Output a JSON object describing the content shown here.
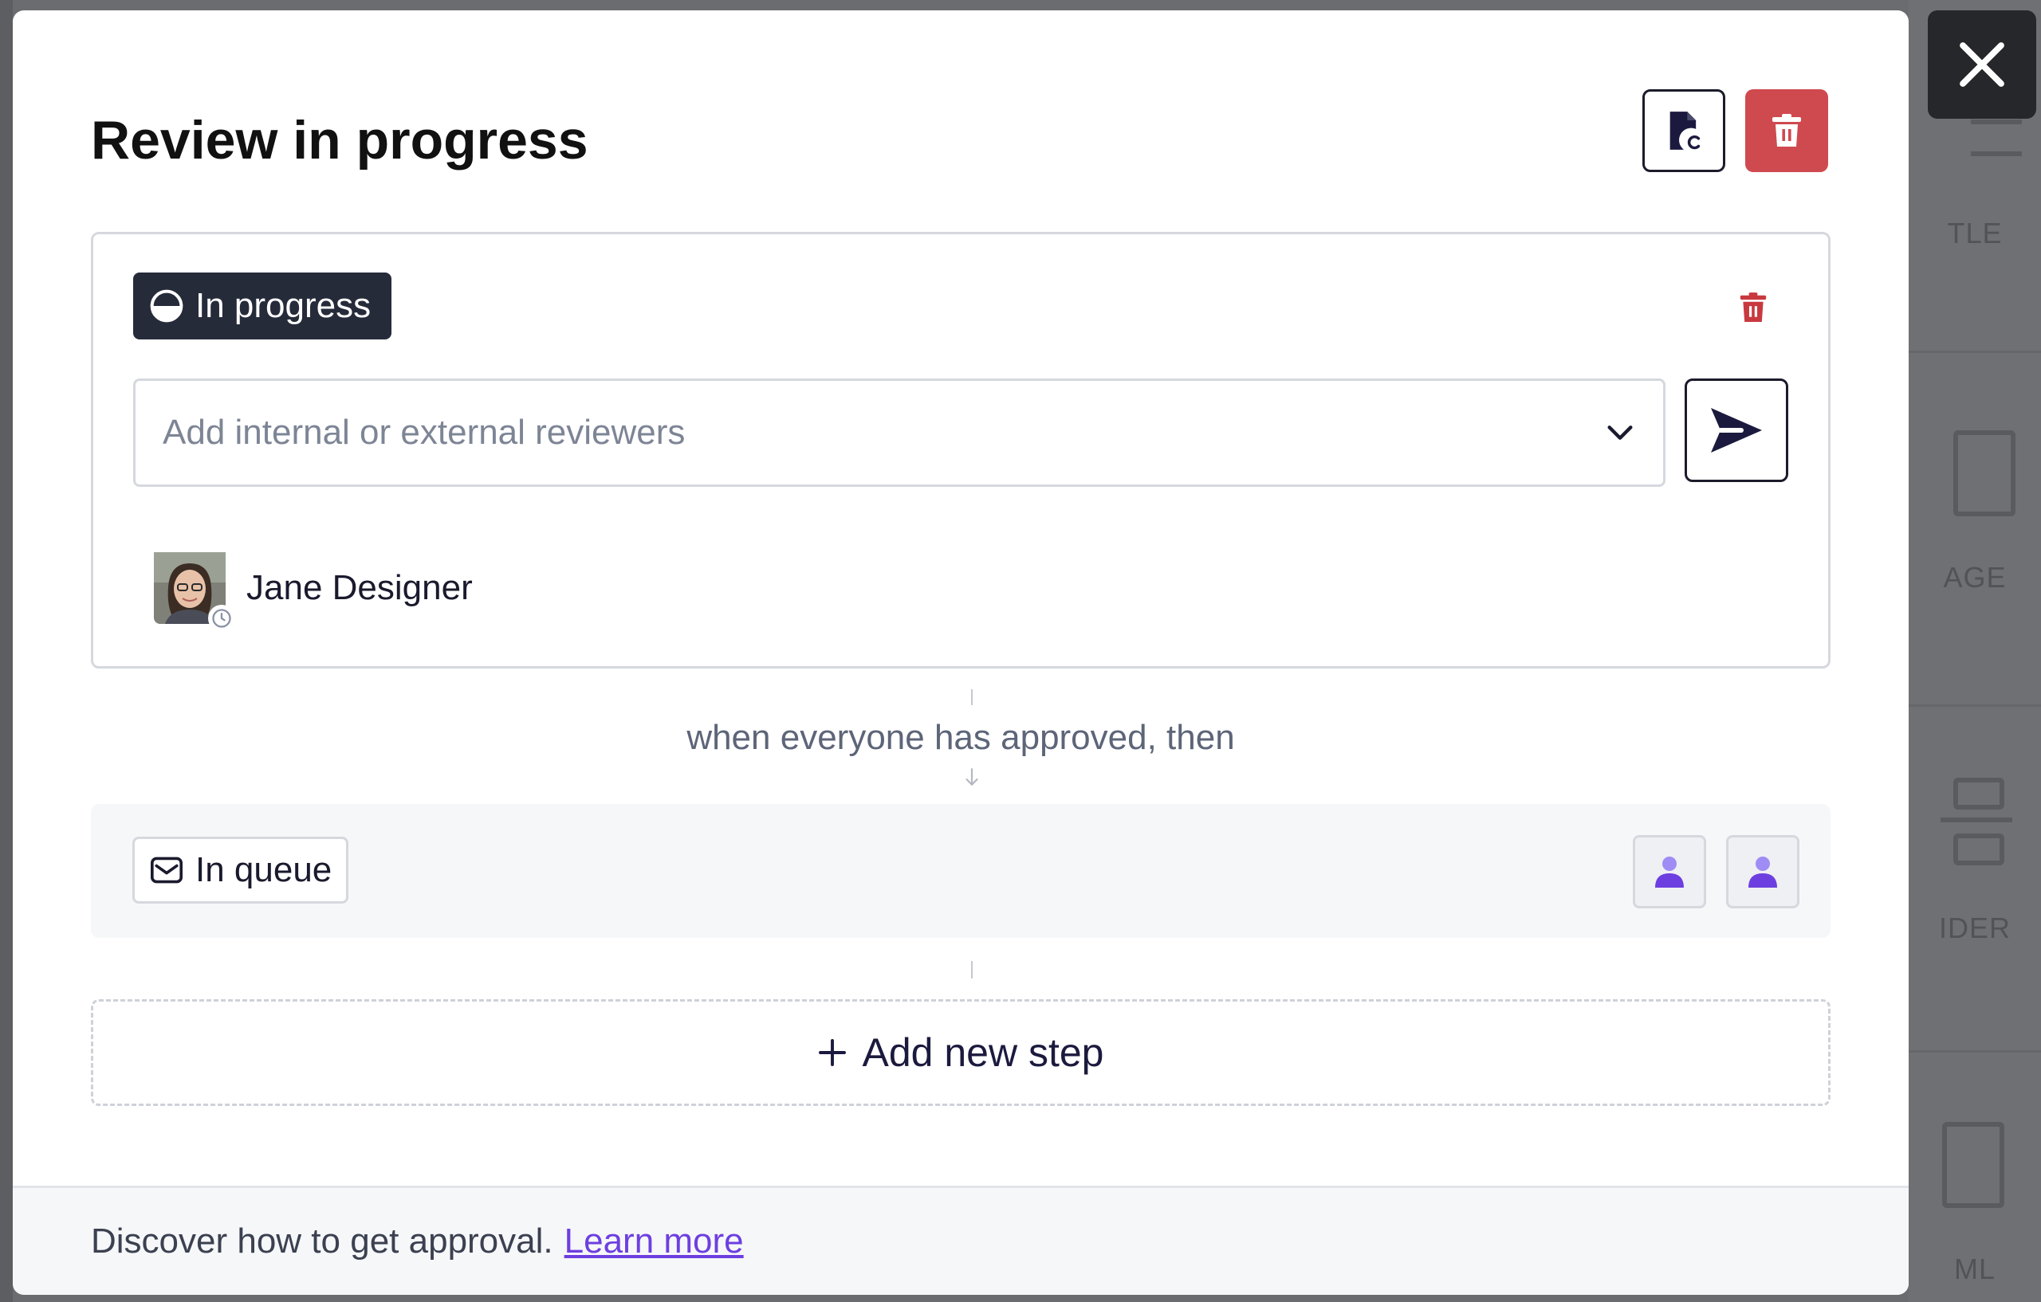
{
  "modal": {
    "title": "Review in progress"
  },
  "step1": {
    "status_label": "In progress",
    "reviewer_placeholder": "Add internal or external reviewers",
    "reviewers": [
      {
        "name": "Jane Designer"
      }
    ]
  },
  "connector": {
    "text": "when everyone has approved, then"
  },
  "step2": {
    "status_label": "In queue"
  },
  "add_step": {
    "label": "Add new step"
  },
  "footer": {
    "text": "Discover how to get approval.",
    "link_label": "Learn more"
  },
  "background": {
    "labels": [
      "TLE",
      "AGE",
      "IDER",
      "ML"
    ]
  },
  "colors": {
    "danger": "#cf4a4f",
    "status_dark": "#262b3a",
    "link": "#6d3fe0",
    "user_icon": "#7b5cf0"
  },
  "icons": {
    "close": "close-icon",
    "doc_copy": "document-copy-icon",
    "trash": "trash-icon",
    "progress": "half-circle-progress-icon",
    "chevron": "chevron-down-icon",
    "send": "send-arrow-icon",
    "mail": "envelope-icon",
    "user": "user-icon",
    "plus": "plus-icon",
    "clock": "clock-icon"
  }
}
